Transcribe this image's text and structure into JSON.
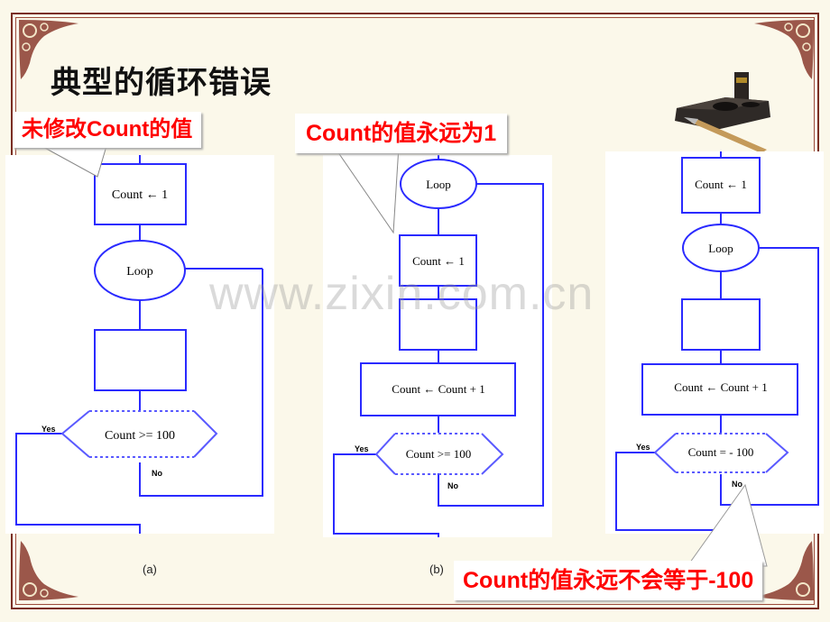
{
  "title": "典型的循环错误",
  "callouts": {
    "a": "未修改Count的值",
    "b": "Count的值永远为1",
    "c": "Count的值永远不会等于-100"
  },
  "diagrams": {
    "a": {
      "caption": "(a)",
      "init": "Count ← 1",
      "loop": "Loop",
      "body": "",
      "decision": "Count >= 100",
      "yes": "Yes",
      "no": "No"
    },
    "b": {
      "caption": "(b)",
      "loop": "Loop",
      "init": "Count ← 1",
      "body": "",
      "increment": "Count ← Count  +  1",
      "decision": "Count >= 100",
      "yes": "Yes",
      "no": "No"
    },
    "c": {
      "init": "Count ← 1",
      "loop": "Loop",
      "body": "",
      "increment": "Count ← Count  +  1",
      "decision": "Count =  - 100",
      "yes": "Yes",
      "no": "No"
    }
  },
  "watermark": "www.zixin.com.cn",
  "colors": {
    "flow_line": "#2a2aff",
    "callout_text": "#ff0000",
    "frame": "#7a2e24",
    "background": "#fbf8ea"
  }
}
